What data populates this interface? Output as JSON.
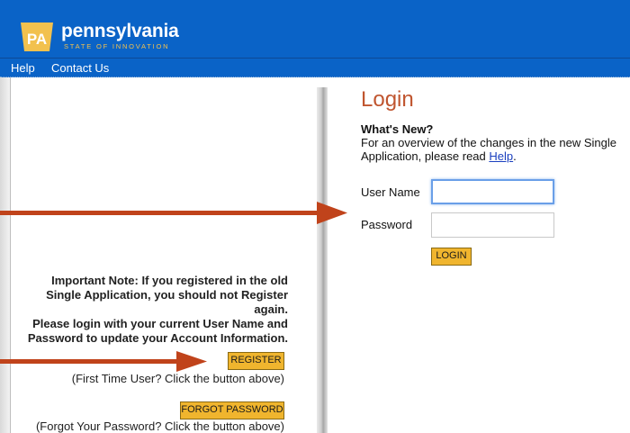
{
  "header": {
    "logo_text": "PA",
    "brand_name": "pennsylvania",
    "brand_tagline": "STATE OF INNOVATION"
  },
  "nav": {
    "help_label": "Help",
    "contact_label": "Contact Us"
  },
  "left_panel": {
    "note_lines": [
      "Important Note: If you registered in the old",
      "Single Application, you should not Register",
      "again.",
      "Please login with your current User Name and",
      "Password to update your Account Information."
    ],
    "register_label": "REGISTER",
    "register_hint": "(First Time User? Click the button above)",
    "forgot_label": "FORGOT PASSWORD",
    "forgot_hint": "(Forgot Your Password? Click the button above)"
  },
  "login": {
    "title": "Login",
    "whats_new_heading": "What's New?",
    "whats_new_text": "For an overview of the changes in the new Single Application, please read",
    "help_link": "Help",
    "period": ".",
    "username_label": "User Name",
    "username_value": "",
    "password_label": "Password",
    "password_value": "",
    "login_button": "LOGIN"
  },
  "colors": {
    "header_blue": "#0a63c7",
    "title_orange": "#c0552f",
    "button_gold": "#f0b52e",
    "arrow_red": "#c0431b"
  }
}
